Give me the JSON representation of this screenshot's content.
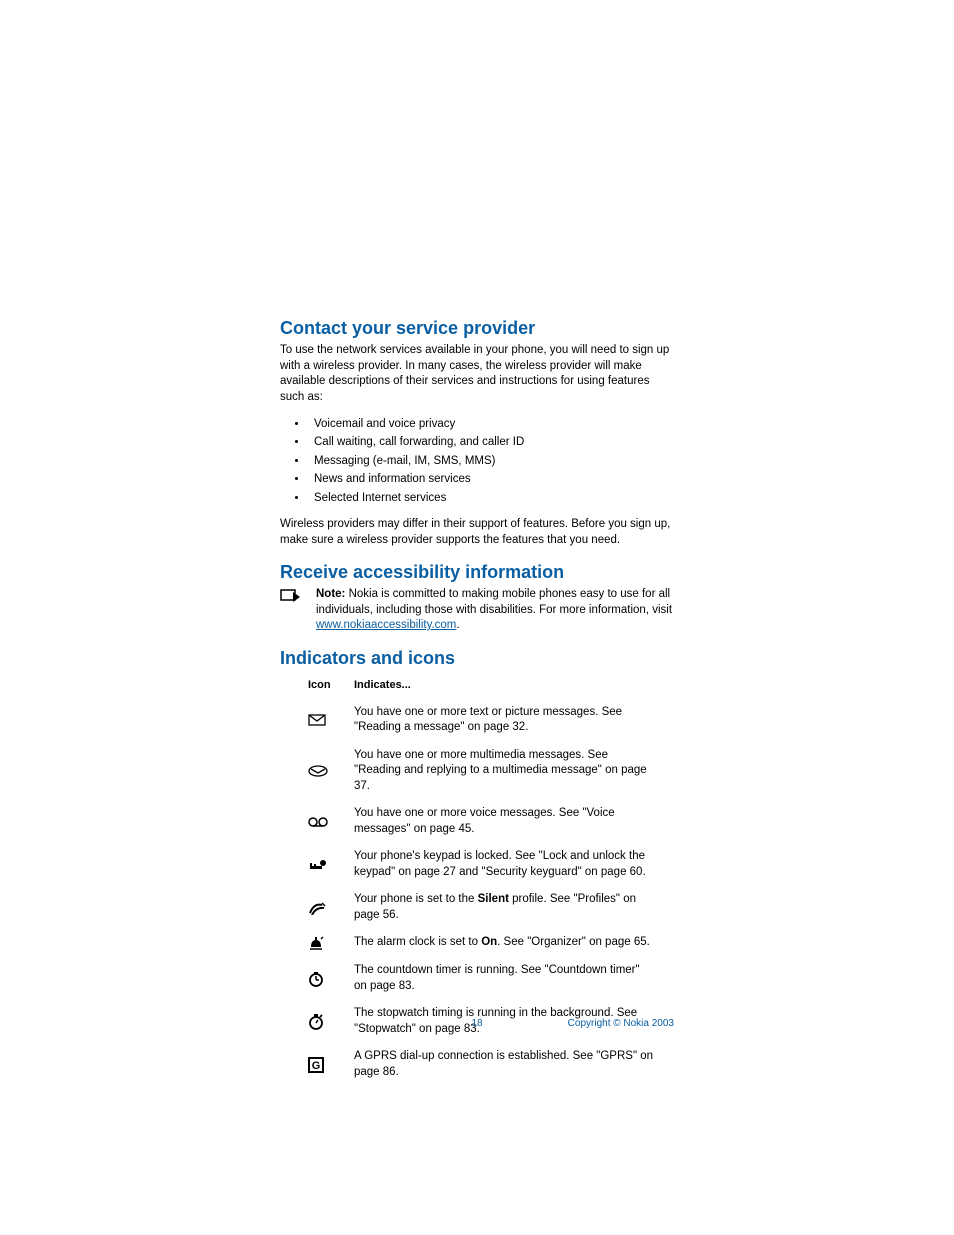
{
  "section1": {
    "heading": "Contact your service provider",
    "intro": "To use the network services available in your phone, you will need to sign up with a wireless provider. In many cases, the wireless provider will make available descriptions of their services and instructions for using features such as:",
    "bullets": [
      "Voicemail and voice privacy",
      "Call waiting, call forwarding, and caller ID",
      "Messaging (e-mail, IM, SMS, MMS)",
      "News and information services",
      "Selected Internet services"
    ],
    "outro": "Wireless providers may differ in their support of features. Before you sign up, make sure a wireless provider supports the features that you need."
  },
  "section2": {
    "heading": "Receive accessibility information",
    "note_label": "Note:",
    "note_body": " Nokia is committed to making mobile phones easy to use for all individuals, including those with disabilities. For more information, visit ",
    "note_link": "www.nokiaaccessibility.com",
    "note_tail": "."
  },
  "section3": {
    "heading": "Indicators and icons",
    "col_icon": "Icon",
    "col_desc": "Indicates...",
    "rows": [
      {
        "icon": "envelope-icon",
        "pre": "You have one or more text or picture messages. See \"Reading a message\" on page 32.",
        "bold": "",
        "post": ""
      },
      {
        "icon": "mms-envelope-icon",
        "pre": "You have one or more multimedia messages. See \"Reading and replying to a multimedia message\" on page 37.",
        "bold": "",
        "post": ""
      },
      {
        "icon": "voicemail-icon",
        "pre": "You have one or more voice messages. See \"Voice messages\" on page 45.",
        "bold": "",
        "post": ""
      },
      {
        "icon": "key-lock-icon",
        "pre": "Your phone's keypad is locked. See \"Lock and unlock the keypad\" on page 27 and \"Security keyguard\" on page 60.",
        "bold": "",
        "post": ""
      },
      {
        "icon": "silent-icon",
        "pre": "Your phone is set to the ",
        "bold": "Silent",
        "post": " profile. See \"Profiles\" on page 56."
      },
      {
        "icon": "alarm-icon",
        "pre": "The alarm clock is set to ",
        "bold": "On",
        "post": ". See \"Organizer\" on page 65."
      },
      {
        "icon": "timer-icon",
        "pre": "The countdown timer is running. See \"Countdown timer\" on page 83.",
        "bold": "",
        "post": ""
      },
      {
        "icon": "stopwatch-icon",
        "pre": "The stopwatch timing is running in the background. See \"Stopwatch\" on page 83.",
        "bold": "",
        "post": ""
      },
      {
        "icon": "gprs-icon",
        "pre": "A GPRS dial-up connection is established. See \"GPRS\" on page 86.",
        "bold": "",
        "post": ""
      }
    ]
  },
  "footer": {
    "page_number": "18",
    "copyright": "Copyright © Nokia 2003"
  }
}
